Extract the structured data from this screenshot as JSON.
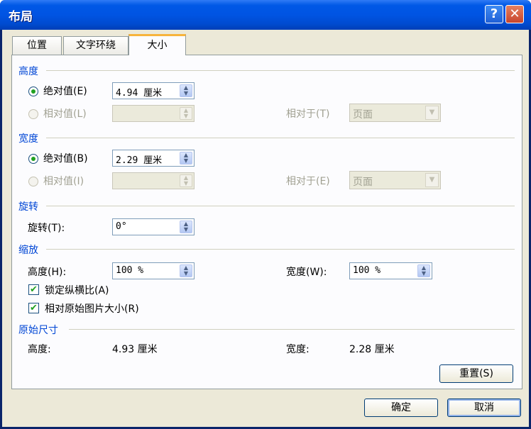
{
  "title": "布局",
  "title_buttons": {
    "help": "?",
    "close": "✕"
  },
  "tabs": [
    "位置",
    "文字环绕",
    "大小"
  ],
  "height": {
    "section": "高度",
    "absolute_label": "绝对值(E)",
    "absolute_value": "4.94 厘米",
    "relative_label": "相对值(L)",
    "relative_value": "",
    "relative_to_label": "相对于(T)",
    "relative_to_value": "页面"
  },
  "width": {
    "section": "宽度",
    "absolute_label": "绝对值(B)",
    "absolute_value": "2.29 厘米",
    "relative_label": "相对值(I)",
    "relative_value": "",
    "relative_to_label": "相对于(E)",
    "relative_to_value": "页面"
  },
  "rotation": {
    "section": "旋转",
    "label": "旋转(T):",
    "value": "0°"
  },
  "scale": {
    "section": "缩放",
    "height_label": "高度(H):",
    "height_value": "100 %",
    "width_label": "宽度(W):",
    "width_value": "100 %",
    "lock_aspect_label": "锁定纵横比(A)",
    "lock_aspect_checked": true,
    "relative_original_label": "相对原始图片大小(R)",
    "relative_original_checked": true
  },
  "original_size": {
    "section": "原始尺寸",
    "height_label": "高度:",
    "height_value": "4.93 厘米",
    "width_label": "宽度:",
    "width_value": "2.28 厘米"
  },
  "buttons": {
    "reset": "重置(S)",
    "ok": "确定",
    "cancel": "取消"
  },
  "colors": {
    "section_heading": "#0046d5",
    "titlebar": "#0054e3",
    "active_tab_accent": "#f7b43c"
  }
}
